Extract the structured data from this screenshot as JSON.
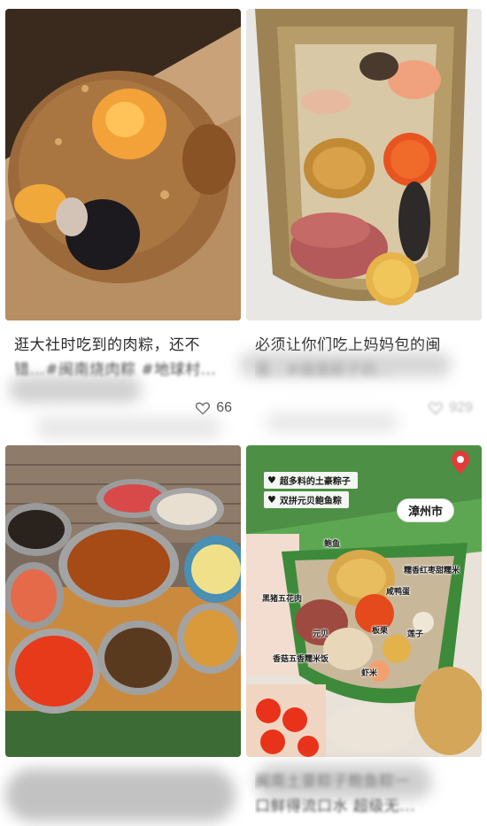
{
  "cards": [
    {
      "title_line1": "逛大社时吃到的肉粽，还不",
      "title_line2": "错...#闽南烧肉粽 #地球村...",
      "likes": "66"
    },
    {
      "title_line1": "必须让你们吃上妈妈包的闽",
      "title_line2": "南...#闽南粽子的...",
      "likes": "929"
    },
    {
      "title_line1": "",
      "title_line2": "",
      "likes": ""
    },
    {
      "title_line1": "闽南土豪粽子鲍鱼粽一",
      "title_line2": "口鲜得流口水 超级无...",
      "likes": ""
    }
  ],
  "overlay": {
    "tag1": "超多料的土豪粽子",
    "tag2": "双拼元贝鲍鱼粽",
    "city": "漳州市",
    "labels": {
      "abalone": "鲍鱼",
      "pork": "黑猪五花肉",
      "egg": "咸鸭蛋",
      "rice": "糯香红枣甜糯米",
      "scallop": "元贝",
      "chestnut": "板栗",
      "lotus": "莲子",
      "shrimp": "虾米",
      "mushroom_rice": "香菇五香糯米饭"
    }
  },
  "colors": {
    "text": "#2b2b2b",
    "likes": "#555555",
    "leaf_green": "#3d8a3a",
    "pin_red": "#e23b3b"
  },
  "icons": {
    "like": "heart-outline-icon",
    "tag_bullet": "heart-solid-icon",
    "location": "location-pin-icon"
  }
}
